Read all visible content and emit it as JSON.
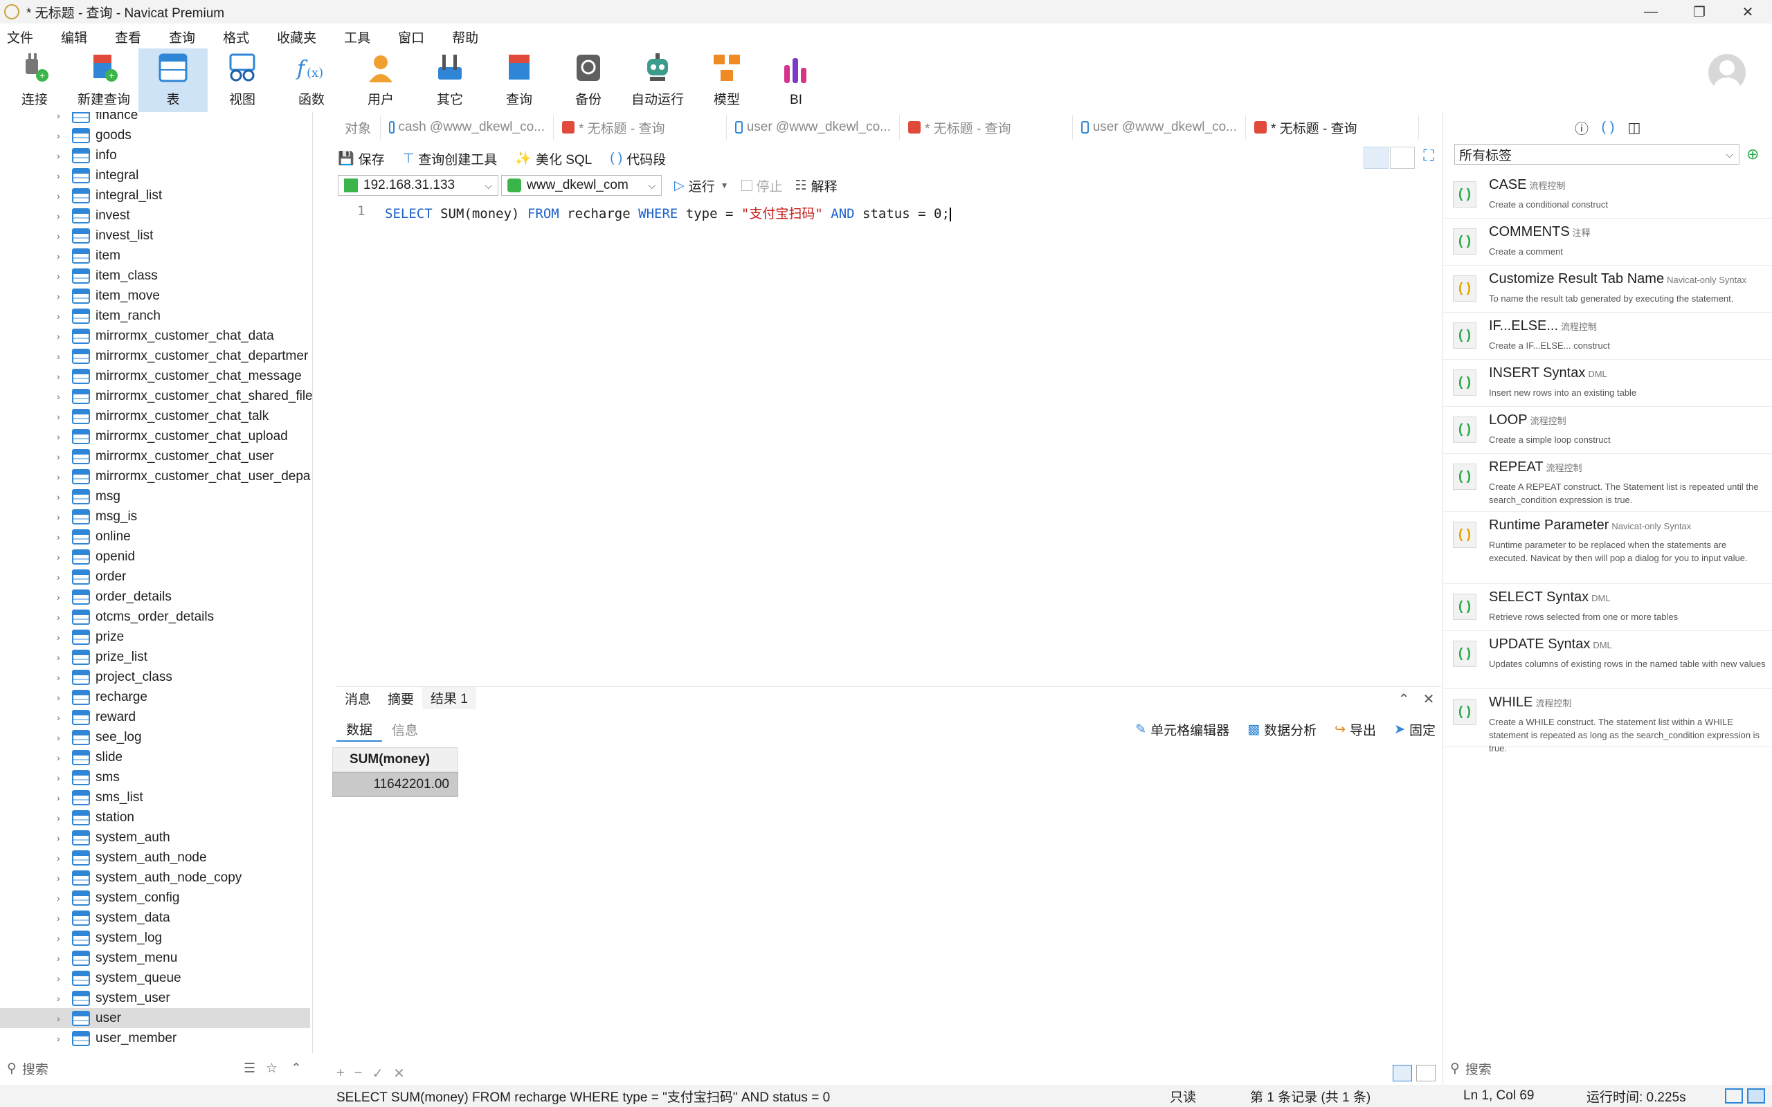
{
  "window": {
    "title": "* 无标题 - 查询 - Navicat Premium",
    "minimize": "—",
    "maximize": "❐",
    "close": "✕"
  },
  "menu": [
    "文件",
    "编辑",
    "查看",
    "查询",
    "格式",
    "收藏夹",
    "工具",
    "窗口",
    "帮助"
  ],
  "toolbar": [
    {
      "label": "连接",
      "icon": "connection-icon"
    },
    {
      "label": "新建查询",
      "icon": "new-query-icon"
    },
    {
      "label": "表",
      "icon": "table-icon",
      "active": true
    },
    {
      "label": "视图",
      "icon": "view-icon"
    },
    {
      "label": "函数",
      "icon": "function-icon"
    },
    {
      "label": "用户",
      "icon": "user-icon"
    },
    {
      "label": "其它",
      "icon": "other-icon"
    },
    {
      "label": "查询",
      "icon": "query-icon"
    },
    {
      "label": "备份",
      "icon": "backup-icon"
    },
    {
      "label": "自动运行",
      "icon": "automation-icon"
    },
    {
      "label": "模型",
      "icon": "model-icon"
    },
    {
      "label": "BI",
      "icon": "bi-icon"
    }
  ],
  "tree": {
    "items": [
      "finance",
      "goods",
      "info",
      "integral",
      "integral_list",
      "invest",
      "invest_list",
      "item",
      "item_class",
      "item_move",
      "item_ranch",
      "mirrormx_customer_chat_data",
      "mirrormx_customer_chat_departmer",
      "mirrormx_customer_chat_message",
      "mirrormx_customer_chat_shared_file",
      "mirrormx_customer_chat_talk",
      "mirrormx_customer_chat_upload",
      "mirrormx_customer_chat_user",
      "mirrormx_customer_chat_user_depa",
      "msg",
      "msg_is",
      "online",
      "openid",
      "order",
      "order_details",
      "otcms_order_details",
      "prize",
      "prize_list",
      "project_class",
      "recharge",
      "reward",
      "see_log",
      "slide",
      "sms",
      "sms_list",
      "station",
      "system_auth",
      "system_auth_node",
      "system_auth_node_copy",
      "system_config",
      "system_data",
      "system_log",
      "system_menu",
      "system_queue",
      "system_user",
      "user",
      "user_member"
    ],
    "selected": "user",
    "search_placeholder": "搜索"
  },
  "tabs": [
    {
      "label": "对象",
      "active": false
    },
    {
      "label": "cash @www_dkewl_co...",
      "active": false
    },
    {
      "label": "* 无标题 - 查询",
      "active": false
    },
    {
      "label": "user @www_dkewl_co...",
      "active": false
    },
    {
      "label": "* 无标题 - 查询",
      "active": false
    },
    {
      "label": "user @www_dkewl_co...",
      "active": false
    },
    {
      "label": "* 无标题 - 查询",
      "active": true
    }
  ],
  "query_toolbar": {
    "save": "保存",
    "builder": "查询创建工具",
    "beautify": "美化 SQL",
    "snippet": "代码段"
  },
  "connection": {
    "host": "192.168.31.133",
    "database": "www_dkewl_com",
    "run": "运行",
    "stop": "停止",
    "explain": "解释"
  },
  "editor": {
    "line_number": "1",
    "kw_select": "SELECT",
    "fn": "SUM(money)",
    "kw_from": "FROM",
    "table": "recharge",
    "kw_where": "WHERE",
    "col_type": "type",
    "eq1": "=",
    "str_val": "\"支付宝扫码\"",
    "kw_and": "AND",
    "col_status": "status",
    "eq2": "=",
    "num_val": "0;"
  },
  "results": {
    "tabs": [
      "消息",
      "摘要",
      "结果 1"
    ],
    "sub_tabs": [
      "数据",
      "信息"
    ],
    "tools": [
      "单元格编辑器",
      "数据分析",
      "导出",
      "固定"
    ],
    "column": "SUM(money)",
    "value": "11642201.00"
  },
  "bottom_controls": [
    "+",
    "−",
    "✓",
    "✕"
  ],
  "status": {
    "sql": "SELECT SUM(money) FROM recharge WHERE type = \"支付宝扫码\" AND status = 0",
    "readonly": "只读",
    "records": "第 1 条记录 (共 1 条)",
    "position": "Ln 1, Col 69",
    "runtime": "运行时间: 0.225s"
  },
  "snippets": {
    "filter": "所有标签",
    "search_placeholder": "搜索",
    "items": [
      {
        "title": "CASE",
        "tag": "流程控制",
        "desc": "Create a conditional construct",
        "color": "green"
      },
      {
        "title": "COMMENTS",
        "tag": "注释",
        "desc": "Create a comment",
        "color": "green"
      },
      {
        "title": "Customize Result Tab Name",
        "tag": "Navicat-only Syntax",
        "desc": "To name the result tab generated by executing the statement.",
        "color": "yellow"
      },
      {
        "title": "IF...ELSE...",
        "tag": "流程控制",
        "desc": "Create a IF...ELSE... construct",
        "color": "green"
      },
      {
        "title": "INSERT Syntax",
        "tag": "DML",
        "desc": "Insert new rows into an existing table",
        "color": "green"
      },
      {
        "title": "LOOP",
        "tag": "流程控制",
        "desc": "Create a simple loop construct",
        "color": "green"
      },
      {
        "title": "REPEAT",
        "tag": "流程控制",
        "desc": "Create A REPEAT construct. The Statement list is repeated until the search_condition expression is true.",
        "color": "green"
      },
      {
        "title": "Runtime Parameter",
        "tag": "Navicat-only Syntax",
        "desc": "Runtime parameter to be replaced when the statements are executed. Navicat by then will pop a dialog for you to input value.",
        "color": "yellow"
      },
      {
        "title": "SELECT Syntax",
        "tag": "DML",
        "desc": "Retrieve rows selected from one or more tables",
        "color": "green"
      },
      {
        "title": "UPDATE Syntax",
        "tag": "DML",
        "desc": "Updates columns of existing rows in the named table with new values",
        "color": "green"
      },
      {
        "title": "WHILE",
        "tag": "流程控制",
        "desc": "Create a WHILE construct. The statement list within a WHILE statement is repeated as long as the search_condition expression is true.",
        "color": "green"
      }
    ]
  }
}
